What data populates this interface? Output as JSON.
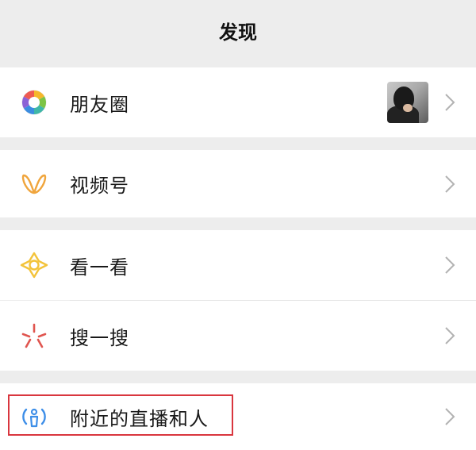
{
  "header": {
    "title": "发现"
  },
  "items": [
    {
      "label": "朋友圈",
      "icon": "moments-icon",
      "has_thumbnail": true
    },
    {
      "label": "视频号",
      "icon": "channels-icon"
    },
    {
      "label": "看一看",
      "icon": "top-stories-icon"
    },
    {
      "label": "搜一搜",
      "icon": "search-icon"
    },
    {
      "label": "附近的直播和人",
      "icon": "nearby-icon",
      "highlighted": true
    }
  ],
  "colors": {
    "background": "#ededed",
    "cell": "#ffffff",
    "highlight_border": "#d9363e",
    "channels_icon": "#f0a53c",
    "top_stories_icon": "#f3c33a",
    "search_icon": "#e0554f",
    "nearby_icon": "#3d8ee8"
  }
}
